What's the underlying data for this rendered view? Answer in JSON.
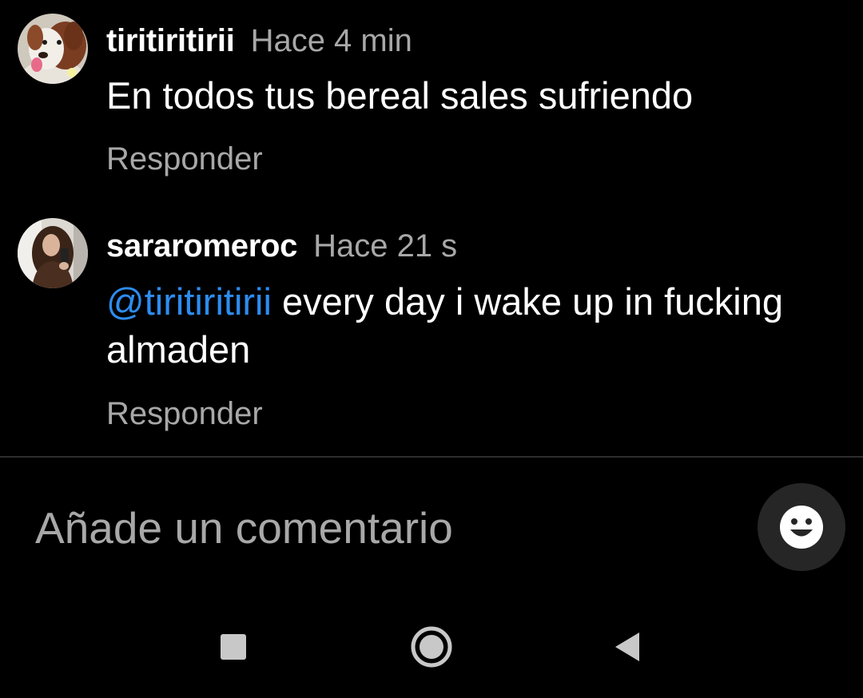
{
  "comments": [
    {
      "username": "tiritiritirii",
      "timestamp": "Hace 4 min",
      "text": "En todos tus bereal sales sufriendo",
      "reply_label": "Responder",
      "avatar_icon": "dog-avatar"
    },
    {
      "username": "sararomeroc",
      "timestamp": "Hace 21 s",
      "mention": "@tiritiritirii",
      "text": " every day i wake up in fucking almaden",
      "reply_label": "Responder",
      "avatar_icon": "woman-avatar"
    }
  ],
  "composer": {
    "placeholder": "Añade un comentario",
    "emoji_icon": "smiley-icon"
  },
  "navbar": {
    "icons": [
      "square-recents-icon",
      "circle-home-icon",
      "triangle-back-icon"
    ]
  },
  "colors": {
    "background": "#000000",
    "text_primary": "#ffffff",
    "text_secondary": "#a8a8a8",
    "mention": "#2d8cf0",
    "emoji_button_bg": "#262626",
    "divider": "#2e2e2e"
  }
}
